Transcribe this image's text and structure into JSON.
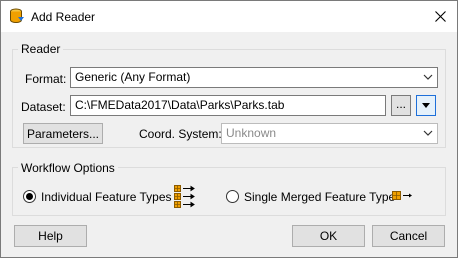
{
  "window": {
    "title": "Add Reader"
  },
  "reader": {
    "group_label": "Reader",
    "format_label": "Format:",
    "format_value": "Generic (Any Format)",
    "dataset_label": "Dataset:",
    "dataset_value": "C:\\FMEData2017\\Data\\Parks\\Parks.tab",
    "browse_label": "...",
    "parameters_label": "Parameters...",
    "coord_label": "Coord. System:",
    "coord_value": "Unknown"
  },
  "workflow": {
    "group_label": "Workflow Options",
    "option1_label": "Individual Feature Types",
    "option1_selected": true,
    "option2_label": "Single Merged Feature Type",
    "option2_selected": false
  },
  "buttons": {
    "help": "Help",
    "ok": "OK",
    "cancel": "Cancel"
  },
  "colors": {
    "accent": "#1e6fd9",
    "icon_brown": "#8b5a00",
    "icon_orange": "#f0a000"
  },
  "icons": {
    "app": "fme-reader-icon",
    "close": "close-icon",
    "dropdown": "chevron-down-icon",
    "individual": "multiple-tables-icon",
    "merged": "single-table-icon"
  }
}
